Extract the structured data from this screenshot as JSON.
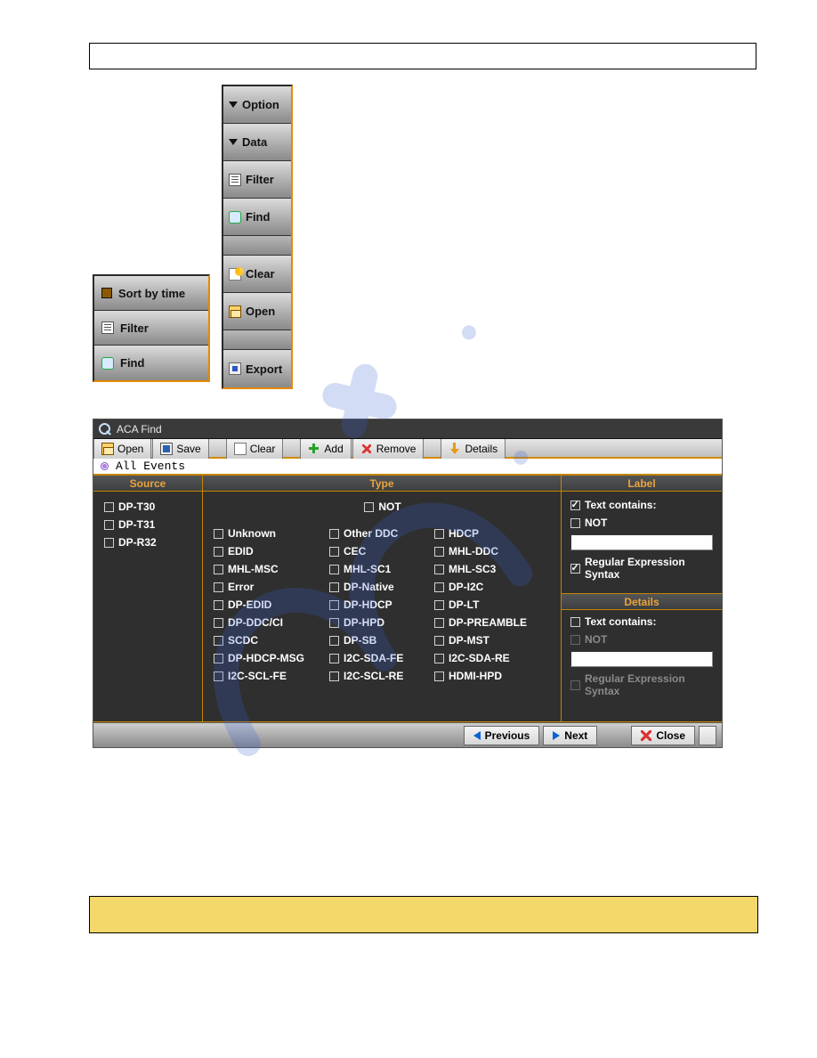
{
  "vtoolbar": {
    "items": [
      {
        "label": "Option"
      },
      {
        "label": "Data"
      },
      {
        "label": "Filter"
      },
      {
        "label": "Find"
      },
      {
        "label": "Clear"
      },
      {
        "label": "Open"
      },
      {
        "label": "Export"
      }
    ]
  },
  "stoolbar": {
    "items": [
      {
        "label": "Sort by time"
      },
      {
        "label": "Filter"
      },
      {
        "label": "Find"
      }
    ]
  },
  "dialog": {
    "title": "ACA Find",
    "toolbar": {
      "open": "Open",
      "save": "Save",
      "clear": "Clear",
      "add": "Add",
      "remove": "Remove",
      "details": "Details"
    },
    "event_row": "All Events",
    "headers": {
      "source": "Source",
      "type": "Type",
      "label": "Label"
    },
    "sources": [
      "DP-T30",
      "DP-T31",
      "DP-R32"
    ],
    "type_not": "NOT",
    "types": [
      [
        "Unknown",
        "Other DDC",
        "HDCP"
      ],
      [
        "EDID",
        "CEC",
        "MHL-DDC"
      ],
      [
        "MHL-MSC",
        "MHL-SC1",
        "MHL-SC3"
      ],
      [
        "Error",
        "DP-Native",
        "DP-I2C"
      ],
      [
        "DP-EDID",
        "DP-HDCP",
        "DP-LT"
      ],
      [
        "DP-DDC/CI",
        "DP-HPD",
        "DP-PREAMBLE"
      ],
      [
        "SCDC",
        "DP-SB",
        "DP-MST"
      ],
      [
        "DP-HDCP-MSG",
        "I2C-SDA-FE",
        "I2C-SDA-RE"
      ],
      [
        "I2C-SCL-FE",
        "I2C-SCL-RE",
        "HDMI-HPD"
      ]
    ],
    "label_panel": {
      "text_contains": "Text contains:",
      "not": "NOT",
      "regex": "Regular Expression Syntax"
    },
    "details_panel": {
      "title": "Details",
      "text_contains": "Text contains:",
      "not": "NOT",
      "regex": "Regular Expression Syntax"
    },
    "footer": {
      "previous": "Previous",
      "next": "Next",
      "close": "Close"
    }
  }
}
